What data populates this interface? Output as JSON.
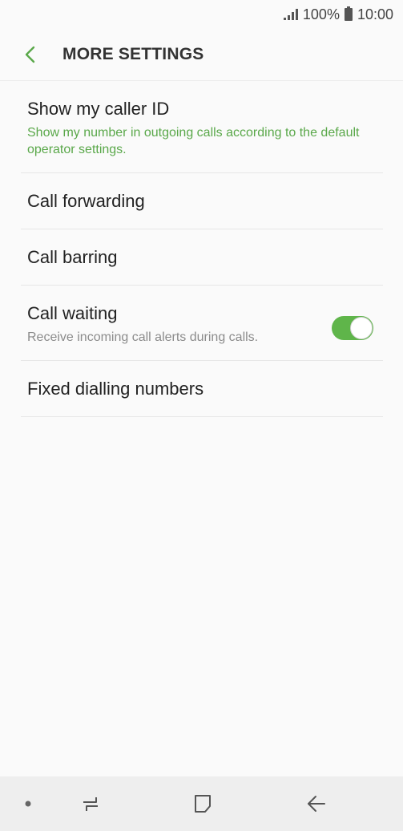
{
  "status": {
    "battery": "100%",
    "time": "10:00"
  },
  "header": {
    "title": "MORE SETTINGS"
  },
  "items": [
    {
      "title": "Show my caller ID",
      "subtitle": "Show my number in outgoing calls according to the default operator settings."
    },
    {
      "title": "Call forwarding"
    },
    {
      "title": "Call barring"
    },
    {
      "title": "Call waiting",
      "subtitle": "Receive incoming call alerts during calls.",
      "toggle_on": true
    },
    {
      "title": "Fixed dialling numbers"
    }
  ],
  "colors": {
    "accent": "#5fb54a",
    "subtitle_green": "#5aa84a",
    "background": "#fafafa"
  },
  "icons": {
    "back": "chevron-left-icon",
    "signal": "signal-icon",
    "battery": "battery-icon",
    "recent": "recent-apps-icon",
    "home": "home-icon",
    "nav_back": "back-arrow-icon"
  }
}
